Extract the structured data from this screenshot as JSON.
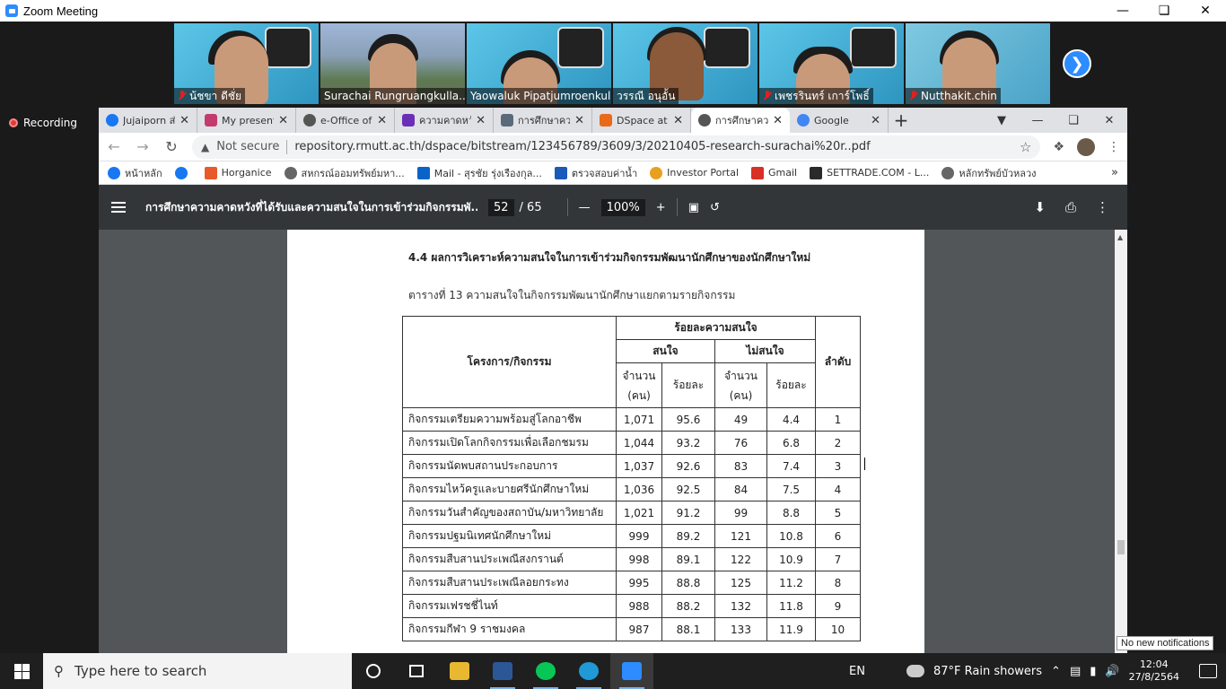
{
  "zoom": {
    "window_title": "Zoom Meeting",
    "recording_label": "Recording",
    "participants": [
      {
        "name": "น้ชขา ดีชั่ย",
        "muted": true
      },
      {
        "name": "Surachai Rungruangkulla...",
        "muted": false
      },
      {
        "name": "Yaowaluk Pipatjumroenkul",
        "muted": false
      },
      {
        "name": "วรรณี อนุอั้น",
        "muted": false
      },
      {
        "name": "เพชรรินทร์ เการ์โพธิ์",
        "muted": true
      },
      {
        "name": "Nutthakit.chin",
        "muted": true
      }
    ]
  },
  "browser": {
    "tabs": [
      {
        "title": "Jujaiporn ส่ง",
        "color": "#1877f2",
        "active": false
      },
      {
        "title": "My present",
        "color": "#c23b6b",
        "active": false
      },
      {
        "title": "e-Office of",
        "color": "#555555",
        "active": false
      },
      {
        "title": "ความคาดหวัง",
        "color": "#6b2fb5",
        "active": false
      },
      {
        "title": "การศึกษาคว",
        "color": "#5a6a7a",
        "active": false
      },
      {
        "title": "DSpace at",
        "color": "#e86a1a",
        "active": false
      },
      {
        "title": "การศึกษาคว",
        "color": "#555555",
        "active": true
      },
      {
        "title": "Google",
        "color": "#4285f4",
        "active": false
      }
    ],
    "not_secure": "Not secure",
    "url": "repository.rmutt.ac.th/dspace/bitstream/123456789/3609/3/20210405-research-surachai%20r..pdf",
    "bookmarks": [
      {
        "label": "หน้าหลัก",
        "color": "#1877f2"
      },
      {
        "label": "",
        "color": "#1877f2"
      },
      {
        "label": "Horganice",
        "color": "#e85a2a"
      },
      {
        "label": "สหกรณ์ออมทรัพย์มหา...",
        "color": "#666666"
      },
      {
        "label": "Mail - สุรชัย รุ่งเรืองกุล...",
        "color": "#0a64c8"
      },
      {
        "label": "ตรวจสอบค่าน้ำ",
        "color": "#1a5ab8"
      },
      {
        "label": "Investor Portal",
        "color": "#e8a020"
      },
      {
        "label": "Gmail",
        "color": "#d93025"
      },
      {
        "label": "SETTRADE.COM - L...",
        "color": "#2a2a2a"
      },
      {
        "label": "หลักทรัพย์บัวหลวง",
        "color": "#666666"
      }
    ]
  },
  "pdf": {
    "title": "การศึกษาความคาดหวังที่ได้รับและความสนใจในการเข้าร่วมกิจกรรมพั...",
    "page_current": "52",
    "page_total": "/ 65",
    "zoom": "100%",
    "section_heading": "4.4 ผลการวิเคราะห์ความสนใจในการเข้าร่วมกิจกรรมพัฒนานักศึกษาของนักศึกษาใหม่",
    "table_caption": "ตารางที่ 13 ความสนใจในกิจกรรมพัฒนานักศึกษาแยกตามรายกิจกรรม",
    "table": {
      "col_activity": "โครงการ/กิจกรรม",
      "col_percent_group": "ร้อยละความสนใจ",
      "col_interested": "สนใจ",
      "col_not_interested": "ไม่สนใจ",
      "col_count": "จำนวน (คน)",
      "col_percent": "ร้อยละ",
      "col_rank": "ลำดับ",
      "rows": [
        {
          "name": "กิจกรรมเตรียมความพร้อมสู่โลกอาชีพ",
          "n1": "1,071",
          "p1": "95.6",
          "n2": "49",
          "p2": "4.4",
          "rank": "1"
        },
        {
          "name": "กิจกรรมเปิดโลกกิจกรรมเพื่อเลือกชมรม",
          "n1": "1,044",
          "p1": "93.2",
          "n2": "76",
          "p2": "6.8",
          "rank": "2"
        },
        {
          "name": "กิจกรรมนัดพบสถานประกอบการ",
          "n1": "1,037",
          "p1": "92.6",
          "n2": "83",
          "p2": "7.4",
          "rank": "3"
        },
        {
          "name": "กิจกรรมไหว้ครูและบายศรีนักศึกษาใหม่",
          "n1": "1,036",
          "p1": "92.5",
          "n2": "84",
          "p2": "7.5",
          "rank": "4"
        },
        {
          "name": "กิจกรรมวันสำคัญของสถาบัน/มหาวิทยาลัย",
          "n1": "1,021",
          "p1": "91.2",
          "n2": "99",
          "p2": "8.8",
          "rank": "5"
        },
        {
          "name": "กิจกรรมปฐมนิเทศนักศึกษาใหม่",
          "n1": "999",
          "p1": "89.2",
          "n2": "121",
          "p2": "10.8",
          "rank": "6"
        },
        {
          "name": "กิจกรรมสืบสานประเพณีสงกรานต์",
          "n1": "998",
          "p1": "89.1",
          "n2": "122",
          "p2": "10.9",
          "rank": "7"
        },
        {
          "name": "กิจกรรมสืบสานประเพณีลอยกระทง",
          "n1": "995",
          "p1": "88.8",
          "n2": "125",
          "p2": "11.2",
          "rank": "8"
        },
        {
          "name": "กิจกรรมเฟรชชี่ไนท์",
          "n1": "988",
          "p1": "88.2",
          "n2": "132",
          "p2": "11.8",
          "rank": "9"
        },
        {
          "name": "กิจกรรมกีฬา 9 ราชมงคล",
          "n1": "987",
          "p1": "88.1",
          "n2": "133",
          "p2": "11.9",
          "rank": "10"
        }
      ]
    }
  },
  "notification": "No new notifications",
  "taskbar": {
    "search_placeholder": "Type here to search",
    "language": "EN",
    "weather": "87°F  Rain showers",
    "time": "12:04",
    "date": "27/8/2564"
  }
}
